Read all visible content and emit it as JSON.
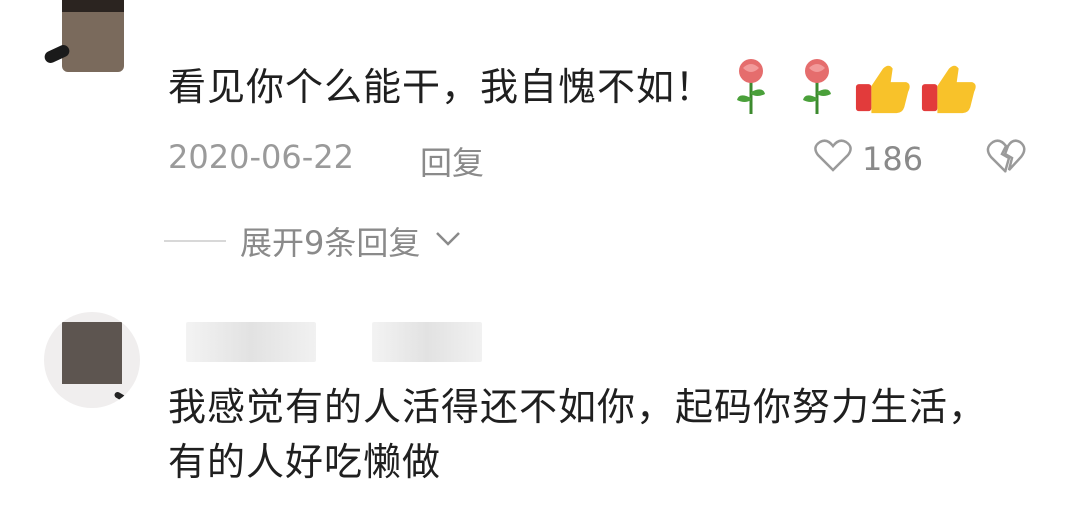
{
  "comment1": {
    "text": "看见你个么能干，我自愧不如！",
    "emojis": [
      "rose-icon",
      "rose-icon",
      "thumbs-up-icon",
      "thumbs-up-icon"
    ],
    "date": "2020-06-22",
    "reply_label": "回复",
    "like_count": "186"
  },
  "replies_toggle": {
    "label": "展开9条回复"
  },
  "comment2": {
    "line1": "我感觉有的人活得还不如你，起码你努力生活，",
    "line2": "有的人好吃懒做"
  }
}
